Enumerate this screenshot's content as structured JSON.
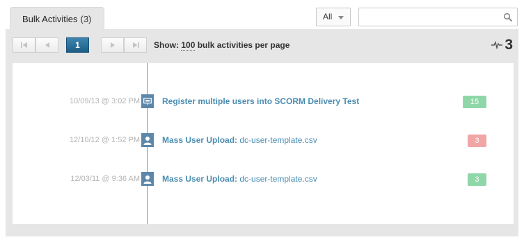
{
  "tab": {
    "label": "Bulk Activities",
    "count": "(3)"
  },
  "filter": {
    "value": "All"
  },
  "search": {
    "placeholder": "",
    "value": ""
  },
  "pager": {
    "first_icon": "first-page-icon",
    "prev_icon": "prev-page-icon",
    "current_page": "1",
    "next_icon": "next-page-icon",
    "last_icon": "last-page-icon"
  },
  "show": {
    "prefix": "Show:",
    "per_page": "100",
    "suffix": "bulk activities per page"
  },
  "total": {
    "icon": "activity-pulse-icon",
    "value": "3"
  },
  "activities": [
    {
      "timestamp": "10/09/13 @ 3:02 PM",
      "icon": "presentation-icon",
      "title_bold": "Register multiple users into SCORM Delivery Test",
      "title_rest": "",
      "badge": "15",
      "badge_color": "#8fd7a8"
    },
    {
      "timestamp": "12/10/12 @ 1:52 PM",
      "icon": "user-icon",
      "title_bold": "Mass User Upload:",
      "title_rest": " dc-user-template.csv",
      "badge": "3",
      "badge_color": "#f2a5a5"
    },
    {
      "timestamp": "12/03/11 @ 9:36 AM",
      "icon": "user-icon",
      "title_bold": "Mass User Upload:",
      "title_rest": " dc-user-template.csv",
      "badge": "3",
      "badge_color": "#8fd7a8"
    }
  ],
  "colors": {
    "accent": "#1f5e86",
    "link": "#4a8db2",
    "timeline": "#5b9bbf",
    "panel": "#e6e6e6"
  }
}
